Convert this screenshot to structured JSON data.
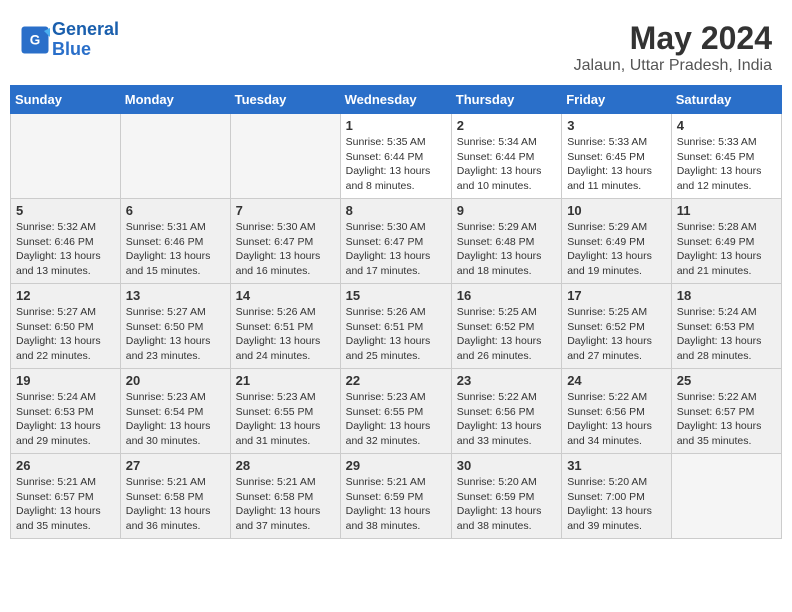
{
  "header": {
    "logo_line1": "General",
    "logo_line2": "Blue",
    "month_year": "May 2024",
    "location": "Jalaun, Uttar Pradesh, India"
  },
  "weekdays": [
    "Sunday",
    "Monday",
    "Tuesday",
    "Wednesday",
    "Thursday",
    "Friday",
    "Saturday"
  ],
  "weeks": [
    [
      {
        "day": "",
        "info": ""
      },
      {
        "day": "",
        "info": ""
      },
      {
        "day": "",
        "info": ""
      },
      {
        "day": "1",
        "info": "Sunrise: 5:35 AM\nSunset: 6:44 PM\nDaylight: 13 hours\nand 8 minutes."
      },
      {
        "day": "2",
        "info": "Sunrise: 5:34 AM\nSunset: 6:44 PM\nDaylight: 13 hours\nand 10 minutes."
      },
      {
        "day": "3",
        "info": "Sunrise: 5:33 AM\nSunset: 6:45 PM\nDaylight: 13 hours\nand 11 minutes."
      },
      {
        "day": "4",
        "info": "Sunrise: 5:33 AM\nSunset: 6:45 PM\nDaylight: 13 hours\nand 12 minutes."
      }
    ],
    [
      {
        "day": "5",
        "info": "Sunrise: 5:32 AM\nSunset: 6:46 PM\nDaylight: 13 hours\nand 13 minutes."
      },
      {
        "day": "6",
        "info": "Sunrise: 5:31 AM\nSunset: 6:46 PM\nDaylight: 13 hours\nand 15 minutes."
      },
      {
        "day": "7",
        "info": "Sunrise: 5:30 AM\nSunset: 6:47 PM\nDaylight: 13 hours\nand 16 minutes."
      },
      {
        "day": "8",
        "info": "Sunrise: 5:30 AM\nSunset: 6:47 PM\nDaylight: 13 hours\nand 17 minutes."
      },
      {
        "day": "9",
        "info": "Sunrise: 5:29 AM\nSunset: 6:48 PM\nDaylight: 13 hours\nand 18 minutes."
      },
      {
        "day": "10",
        "info": "Sunrise: 5:29 AM\nSunset: 6:49 PM\nDaylight: 13 hours\nand 19 minutes."
      },
      {
        "day": "11",
        "info": "Sunrise: 5:28 AM\nSunset: 6:49 PM\nDaylight: 13 hours\nand 21 minutes."
      }
    ],
    [
      {
        "day": "12",
        "info": "Sunrise: 5:27 AM\nSunset: 6:50 PM\nDaylight: 13 hours\nand 22 minutes."
      },
      {
        "day": "13",
        "info": "Sunrise: 5:27 AM\nSunset: 6:50 PM\nDaylight: 13 hours\nand 23 minutes."
      },
      {
        "day": "14",
        "info": "Sunrise: 5:26 AM\nSunset: 6:51 PM\nDaylight: 13 hours\nand 24 minutes."
      },
      {
        "day": "15",
        "info": "Sunrise: 5:26 AM\nSunset: 6:51 PM\nDaylight: 13 hours\nand 25 minutes."
      },
      {
        "day": "16",
        "info": "Sunrise: 5:25 AM\nSunset: 6:52 PM\nDaylight: 13 hours\nand 26 minutes."
      },
      {
        "day": "17",
        "info": "Sunrise: 5:25 AM\nSunset: 6:52 PM\nDaylight: 13 hours\nand 27 minutes."
      },
      {
        "day": "18",
        "info": "Sunrise: 5:24 AM\nSunset: 6:53 PM\nDaylight: 13 hours\nand 28 minutes."
      }
    ],
    [
      {
        "day": "19",
        "info": "Sunrise: 5:24 AM\nSunset: 6:53 PM\nDaylight: 13 hours\nand 29 minutes."
      },
      {
        "day": "20",
        "info": "Sunrise: 5:23 AM\nSunset: 6:54 PM\nDaylight: 13 hours\nand 30 minutes."
      },
      {
        "day": "21",
        "info": "Sunrise: 5:23 AM\nSunset: 6:55 PM\nDaylight: 13 hours\nand 31 minutes."
      },
      {
        "day": "22",
        "info": "Sunrise: 5:23 AM\nSunset: 6:55 PM\nDaylight: 13 hours\nand 32 minutes."
      },
      {
        "day": "23",
        "info": "Sunrise: 5:22 AM\nSunset: 6:56 PM\nDaylight: 13 hours\nand 33 minutes."
      },
      {
        "day": "24",
        "info": "Sunrise: 5:22 AM\nSunset: 6:56 PM\nDaylight: 13 hours\nand 34 minutes."
      },
      {
        "day": "25",
        "info": "Sunrise: 5:22 AM\nSunset: 6:57 PM\nDaylight: 13 hours\nand 35 minutes."
      }
    ],
    [
      {
        "day": "26",
        "info": "Sunrise: 5:21 AM\nSunset: 6:57 PM\nDaylight: 13 hours\nand 35 minutes."
      },
      {
        "day": "27",
        "info": "Sunrise: 5:21 AM\nSunset: 6:58 PM\nDaylight: 13 hours\nand 36 minutes."
      },
      {
        "day": "28",
        "info": "Sunrise: 5:21 AM\nSunset: 6:58 PM\nDaylight: 13 hours\nand 37 minutes."
      },
      {
        "day": "29",
        "info": "Sunrise: 5:21 AM\nSunset: 6:59 PM\nDaylight: 13 hours\nand 38 minutes."
      },
      {
        "day": "30",
        "info": "Sunrise: 5:20 AM\nSunset: 6:59 PM\nDaylight: 13 hours\nand 38 minutes."
      },
      {
        "day": "31",
        "info": "Sunrise: 5:20 AM\nSunset: 7:00 PM\nDaylight: 13 hours\nand 39 minutes."
      },
      {
        "day": "",
        "info": ""
      }
    ]
  ]
}
